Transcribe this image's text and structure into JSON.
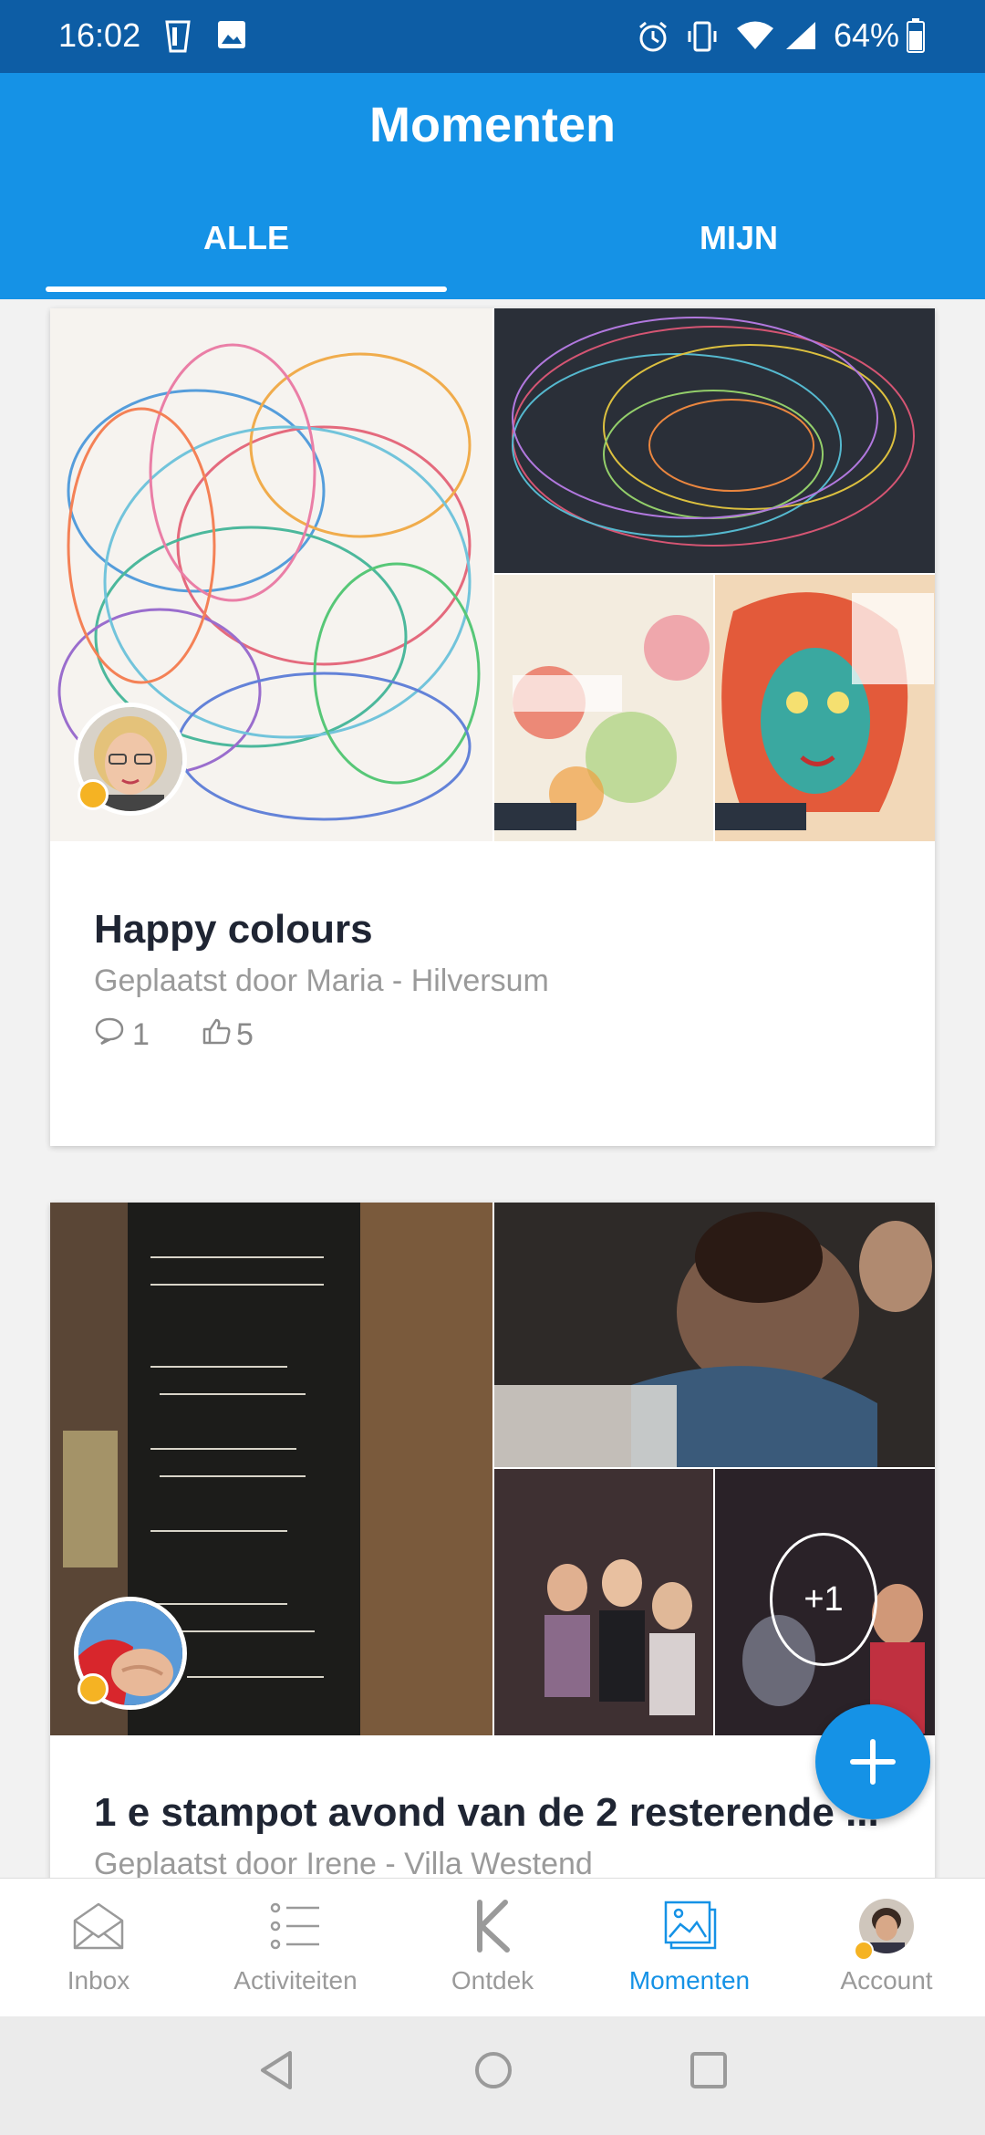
{
  "status_bar": {
    "time": "16:02",
    "battery": "64%"
  },
  "header": {
    "title": "Momenten"
  },
  "tabs": [
    {
      "label": "ALLE",
      "active": true
    },
    {
      "label": "MIJN",
      "active": false
    }
  ],
  "posts": [
    {
      "title": "Happy colours",
      "subtitle": "Geplaatst door Maria - Hilversum",
      "comments": "1",
      "likes": "5"
    },
    {
      "title": "1 e stampot avond van de 2 resterende ...",
      "subtitle": "Geplaatst door Irene - Villa Westend",
      "more_photos": "+1"
    }
  ],
  "bottom_nav": [
    {
      "label": "Inbox",
      "icon": "envelope-icon",
      "active": false
    },
    {
      "label": "Activiteiten",
      "icon": "list-icon",
      "active": false
    },
    {
      "label": "Ontdek",
      "icon": "k-logo-icon",
      "active": false
    },
    {
      "label": "Momenten",
      "icon": "photos-icon",
      "active": true
    },
    {
      "label": "Account",
      "icon": "avatar-icon",
      "active": false
    }
  ],
  "colors": {
    "brand": "#1592e6",
    "status_bar": "#0d5da5",
    "badge": "#f5b323"
  }
}
